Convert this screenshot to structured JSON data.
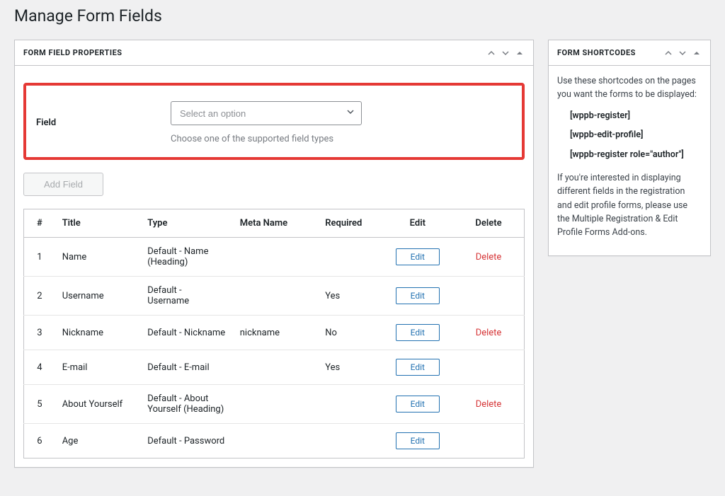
{
  "page_title": "Manage Form Fields",
  "panel_main": {
    "title": "FORM FIELD PROPERTIES",
    "field_label": "Field",
    "select_placeholder": "Select an option",
    "field_help": "Choose one of the supported field types",
    "add_button": "Add Field",
    "table": {
      "headers": {
        "num": "#",
        "title": "Title",
        "type": "Type",
        "meta": "Meta Name",
        "required": "Required",
        "edit": "Edit",
        "delete": "Delete"
      },
      "rows": [
        {
          "num": "1",
          "title": "Name",
          "type": "Default - Name (Heading)",
          "meta": "",
          "required": "",
          "edit": "Edit",
          "del": "Delete"
        },
        {
          "num": "2",
          "title": "Username",
          "type": "Default - Username",
          "meta": "",
          "required": "Yes",
          "edit": "Edit",
          "del": ""
        },
        {
          "num": "3",
          "title": "Nickname",
          "type": "Default - Nickname",
          "meta": "nickname",
          "required": "No",
          "edit": "Edit",
          "del": "Delete"
        },
        {
          "num": "4",
          "title": "E-mail",
          "type": "Default - E-mail",
          "meta": "",
          "required": "Yes",
          "edit": "Edit",
          "del": ""
        },
        {
          "num": "5",
          "title": "About Yourself",
          "type": "Default - About Yourself (Heading)",
          "meta": "",
          "required": "",
          "edit": "Edit",
          "del": "Delete"
        },
        {
          "num": "6",
          "title": "Age",
          "type": "Default - Password",
          "meta": "",
          "required": "",
          "edit": "Edit",
          "del": ""
        }
      ]
    }
  },
  "panel_side": {
    "title": "FORM SHORTCODES",
    "intro": "Use these shortcodes on the pages you want the forms to be displayed:",
    "codes": [
      "[wppb-register]",
      "[wppb-edit-profile]",
      "[wppb-register role=\"author\"]"
    ],
    "outro": "If you're interested in displaying different fields in the registration and edit profile forms, please use the Multiple Registration & Edit Profile Forms Add-ons."
  }
}
